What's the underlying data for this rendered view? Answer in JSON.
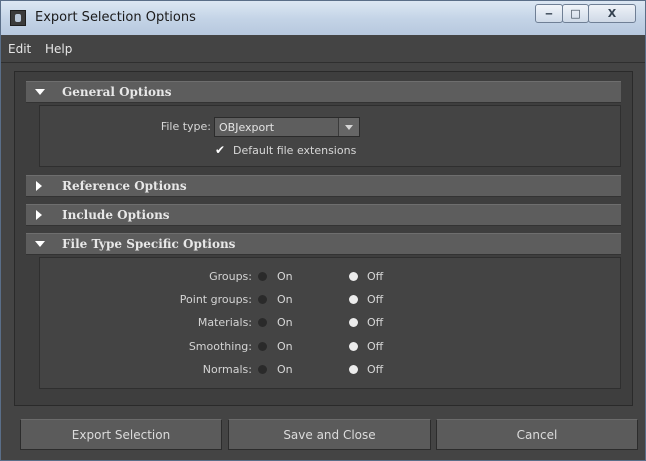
{
  "window": {
    "title": "Export Selection Options",
    "min_glyph": "‒",
    "max_glyph": "□",
    "close_glyph": "X"
  },
  "menu": [
    "Edit",
    "Help"
  ],
  "sections": {
    "general": {
      "title": "General Options",
      "expanded": true
    },
    "reference": {
      "title": "Reference Options",
      "expanded": false
    },
    "include": {
      "title": "Include Options",
      "expanded": false
    },
    "filetype": {
      "title": "File Type Specific Options",
      "expanded": true
    }
  },
  "general": {
    "file_type_label": "File type:",
    "file_type_value": "OBJexport",
    "default_ext_label": "Default file extensions",
    "default_ext_checked": true,
    "check_glyph": "✔"
  },
  "options": [
    {
      "label": "Groups:",
      "on": "On",
      "off": "Off",
      "selected": "Off"
    },
    {
      "label": "Point groups:",
      "on": "On",
      "off": "Off",
      "selected": "Off"
    },
    {
      "label": "Materials:",
      "on": "On",
      "off": "Off",
      "selected": "Off"
    },
    {
      "label": "Smoothing:",
      "on": "On",
      "off": "Off",
      "selected": "Off"
    },
    {
      "label": "Normals:",
      "on": "On",
      "off": "Off",
      "selected": "Off"
    }
  ],
  "buttons": {
    "export": "Export Selection",
    "save_close": "Save and Close",
    "cancel": "Cancel"
  },
  "colors": {
    "panel": "#444444",
    "header": "#5d5d5d",
    "titlebar": "#c3d3e6",
    "text": "#d8d8d8"
  }
}
